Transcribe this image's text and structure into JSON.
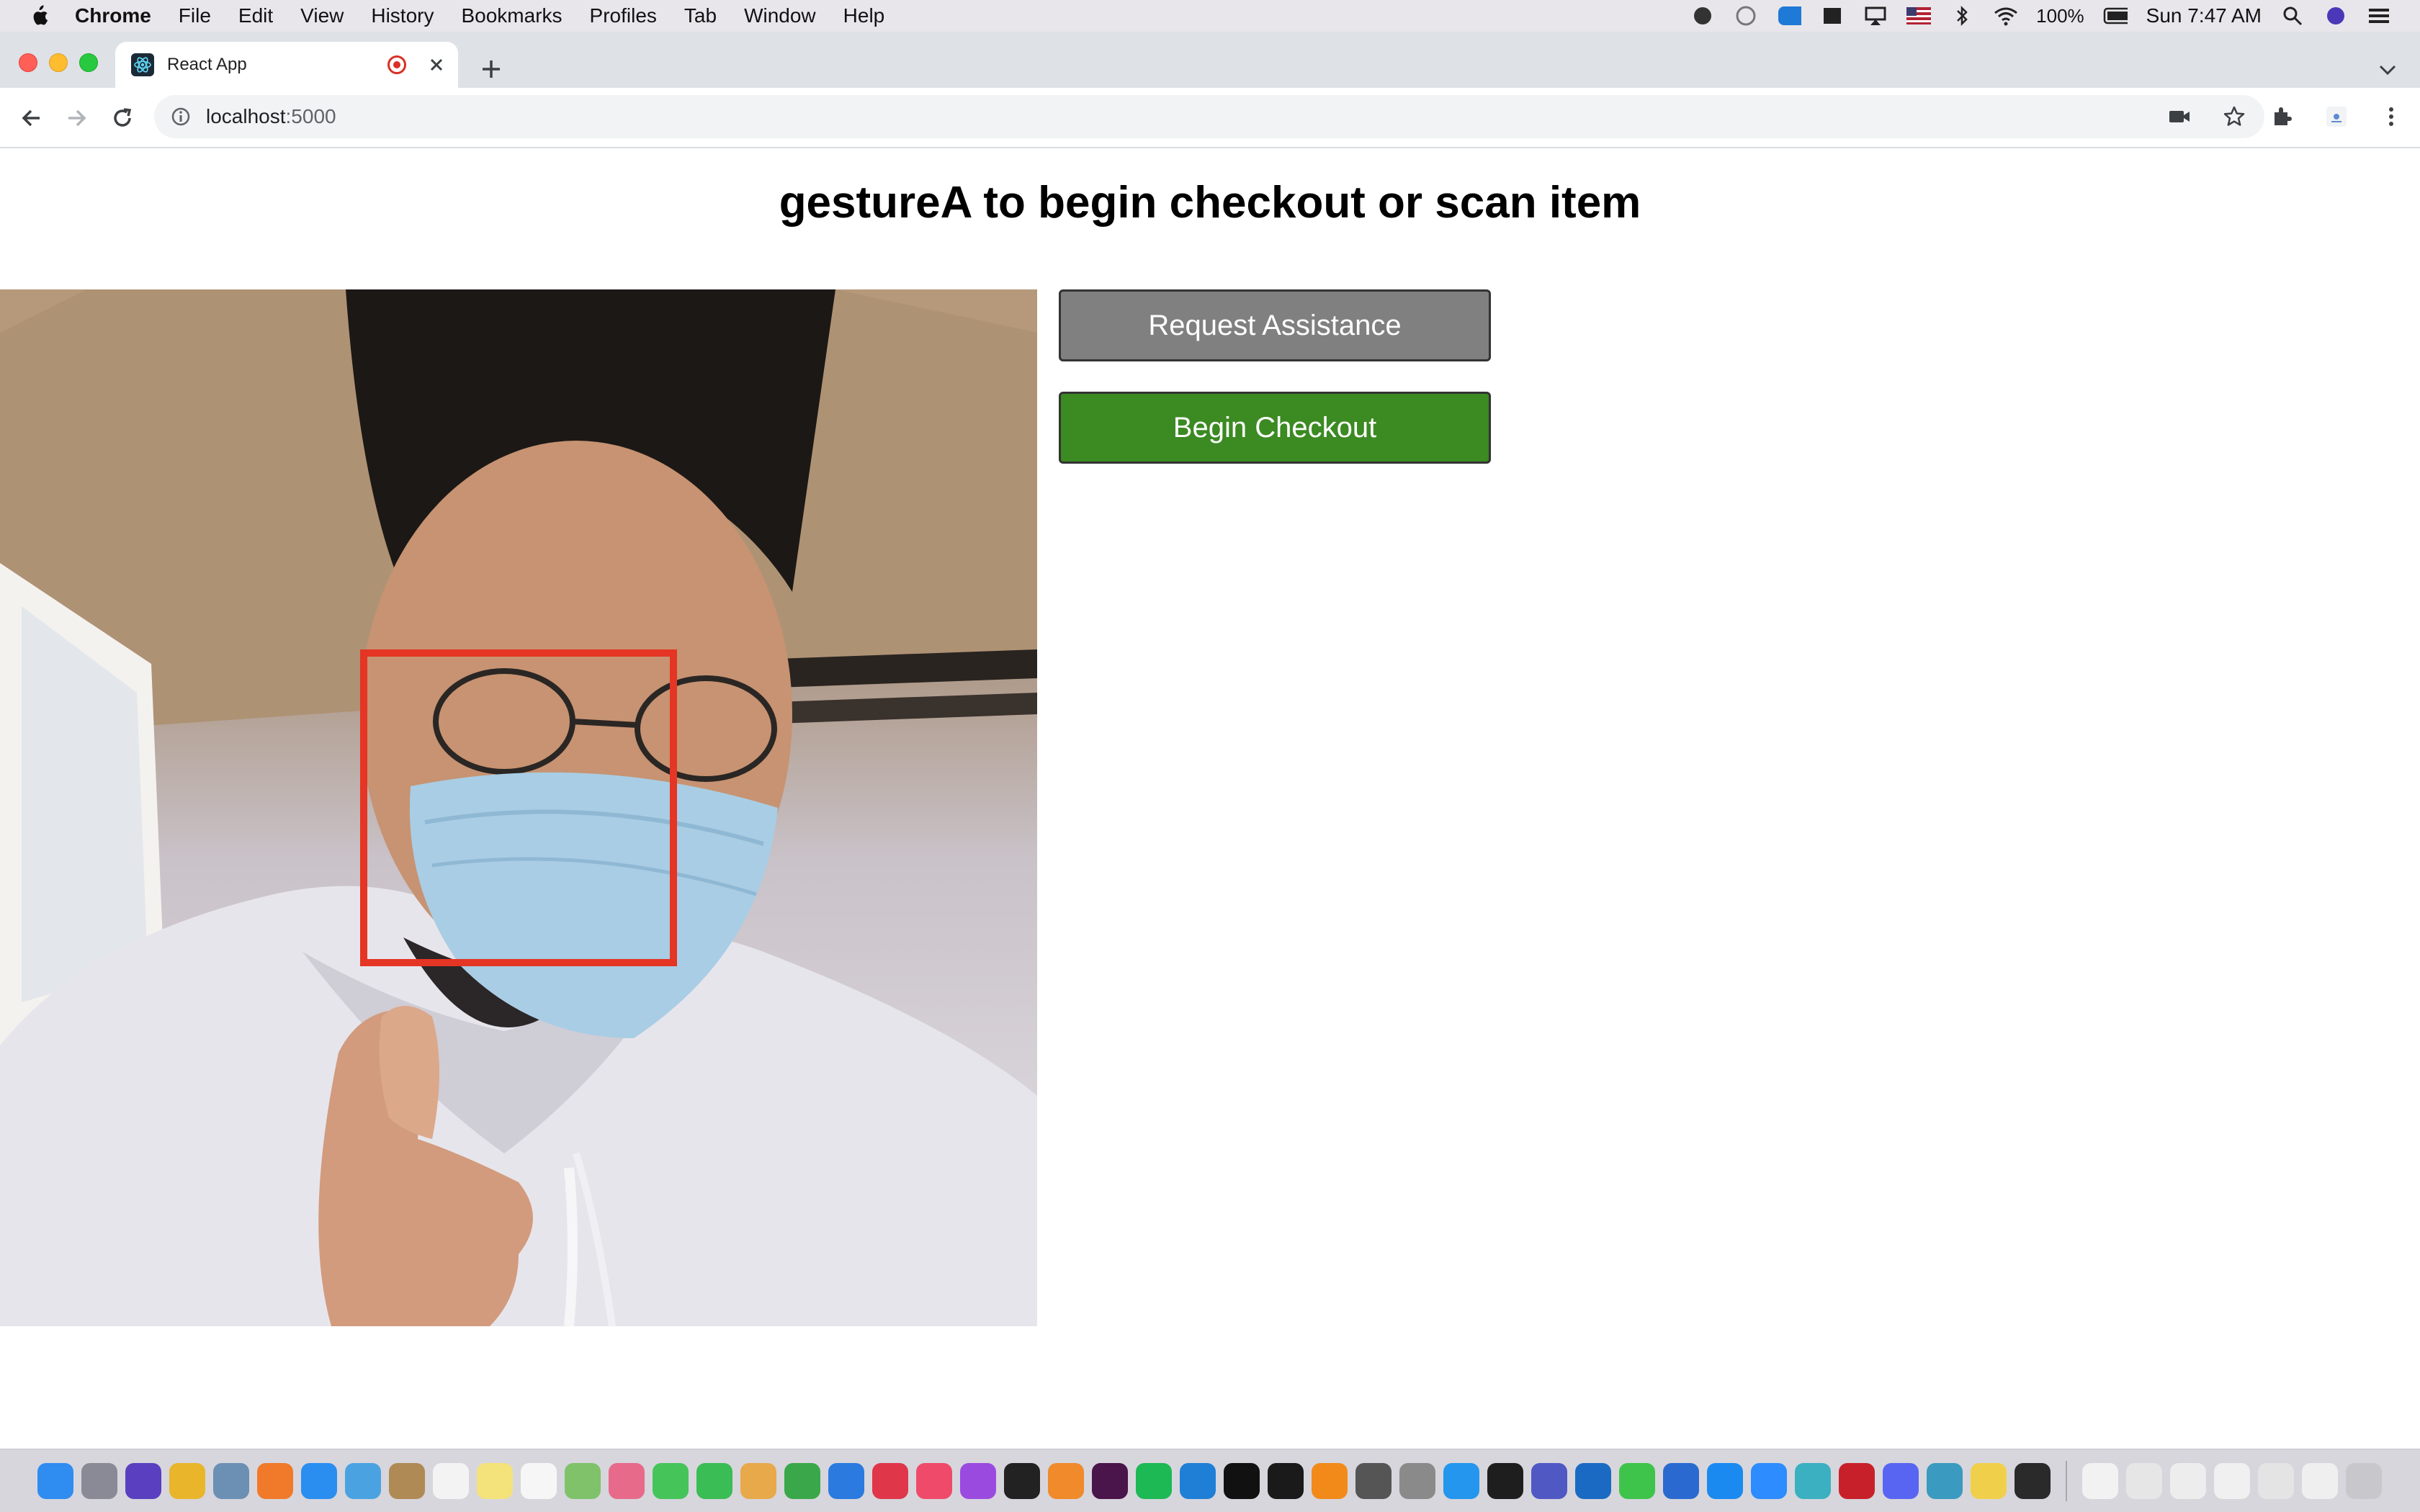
{
  "menubar": {
    "app_name": "Chrome",
    "items": [
      "File",
      "Edit",
      "View",
      "History",
      "Bookmarks",
      "Profiles",
      "Tab",
      "Window",
      "Help"
    ],
    "battery": "100%",
    "clock": "Sun 7:47 AM"
  },
  "browser": {
    "tab_title": "React App",
    "url_host": "localhost",
    "url_port": ":5000"
  },
  "page": {
    "title": "gestureA to begin checkout or scan item",
    "buttons": {
      "request_assistance": "Request Assistance",
      "begin_checkout": "Begin Checkout"
    }
  },
  "colors": {
    "assist_button": "#808080",
    "checkout_button": "#3b8a22",
    "detection_box": "#e53524"
  },
  "dock": {
    "apps": [
      {
        "name": "finder",
        "color": "#2f8cf0"
      },
      {
        "name": "launchpad",
        "color": "#8a8a96"
      },
      {
        "name": "siri",
        "color": "#5a3fc0"
      },
      {
        "name": "chrome",
        "color": "#e9b52a"
      },
      {
        "name": "mail-app",
        "color": "#6c8fb4"
      },
      {
        "name": "firefox",
        "color": "#f07a2a"
      },
      {
        "name": "safari",
        "color": "#2a8ef0"
      },
      {
        "name": "maps",
        "color": "#4aa3e0"
      },
      {
        "name": "notes-brown",
        "color": "#b08a55"
      },
      {
        "name": "calendar",
        "color": "#f3f3f3"
      },
      {
        "name": "notes",
        "color": "#f4e27a"
      },
      {
        "name": "reminders",
        "color": "#f6f6f6"
      },
      {
        "name": "maps-2",
        "color": "#7fc26a"
      },
      {
        "name": "photos",
        "color": "#e86a8a"
      },
      {
        "name": "messages",
        "color": "#45c45a"
      },
      {
        "name": "facetime",
        "color": "#3bbd55"
      },
      {
        "name": "preview",
        "color": "#e8a94a"
      },
      {
        "name": "numbers",
        "color": "#3aa84a"
      },
      {
        "name": "keynote",
        "color": "#2a7ae0"
      },
      {
        "name": "news",
        "color": "#e0364a"
      },
      {
        "name": "music",
        "color": "#f04a6a"
      },
      {
        "name": "podcasts",
        "color": "#9b4ae0"
      },
      {
        "name": "tv",
        "color": "#222222"
      },
      {
        "name": "books",
        "color": "#f08a2a"
      },
      {
        "name": "slack",
        "color": "#4a154b"
      },
      {
        "name": "spotify",
        "color": "#1db954"
      },
      {
        "name": "vscode",
        "color": "#1f7fd6"
      },
      {
        "name": "intellij",
        "color": "#111111"
      },
      {
        "name": "pycharm",
        "color": "#1a1a1a"
      },
      {
        "name": "sublime",
        "color": "#f28a1a"
      },
      {
        "name": "texmaker",
        "color": "#555555"
      },
      {
        "name": "system-prefs",
        "color": "#8a8a8a"
      },
      {
        "name": "docker",
        "color": "#2496ed"
      },
      {
        "name": "terminal",
        "color": "#1e1e1e"
      },
      {
        "name": "teams",
        "color": "#5058c4"
      },
      {
        "name": "outlook",
        "color": "#1a6ac4"
      },
      {
        "name": "wechat",
        "color": "#3ec44a"
      },
      {
        "name": "bbedit",
        "color": "#2a6ad0"
      },
      {
        "name": "app-store",
        "color": "#1a8af0"
      },
      {
        "name": "zoom",
        "color": "#2d8cff"
      },
      {
        "name": "asterisk-app",
        "color": "#3ab0c0"
      },
      {
        "name": "star-app",
        "color": "#c8202a"
      },
      {
        "name": "discord",
        "color": "#5865f2"
      },
      {
        "name": "globe-app",
        "color": "#3a9ac0"
      },
      {
        "name": "python",
        "color": "#f0d04a"
      },
      {
        "name": "activity-monitor",
        "color": "#2a2a2a"
      },
      {
        "name": "document",
        "color": "#f2f2f2"
      },
      {
        "name": "downloads-stack",
        "color": "#e6e6e6"
      },
      {
        "name": "screenshots-stack",
        "color": "#ededed"
      },
      {
        "name": "files-stack",
        "color": "#f0f0f0"
      },
      {
        "name": "screens-stack",
        "color": "#e4e4e4"
      },
      {
        "name": "folder-stack",
        "color": "#efefef"
      },
      {
        "name": "trash",
        "color": "#c8c8cc"
      }
    ]
  }
}
